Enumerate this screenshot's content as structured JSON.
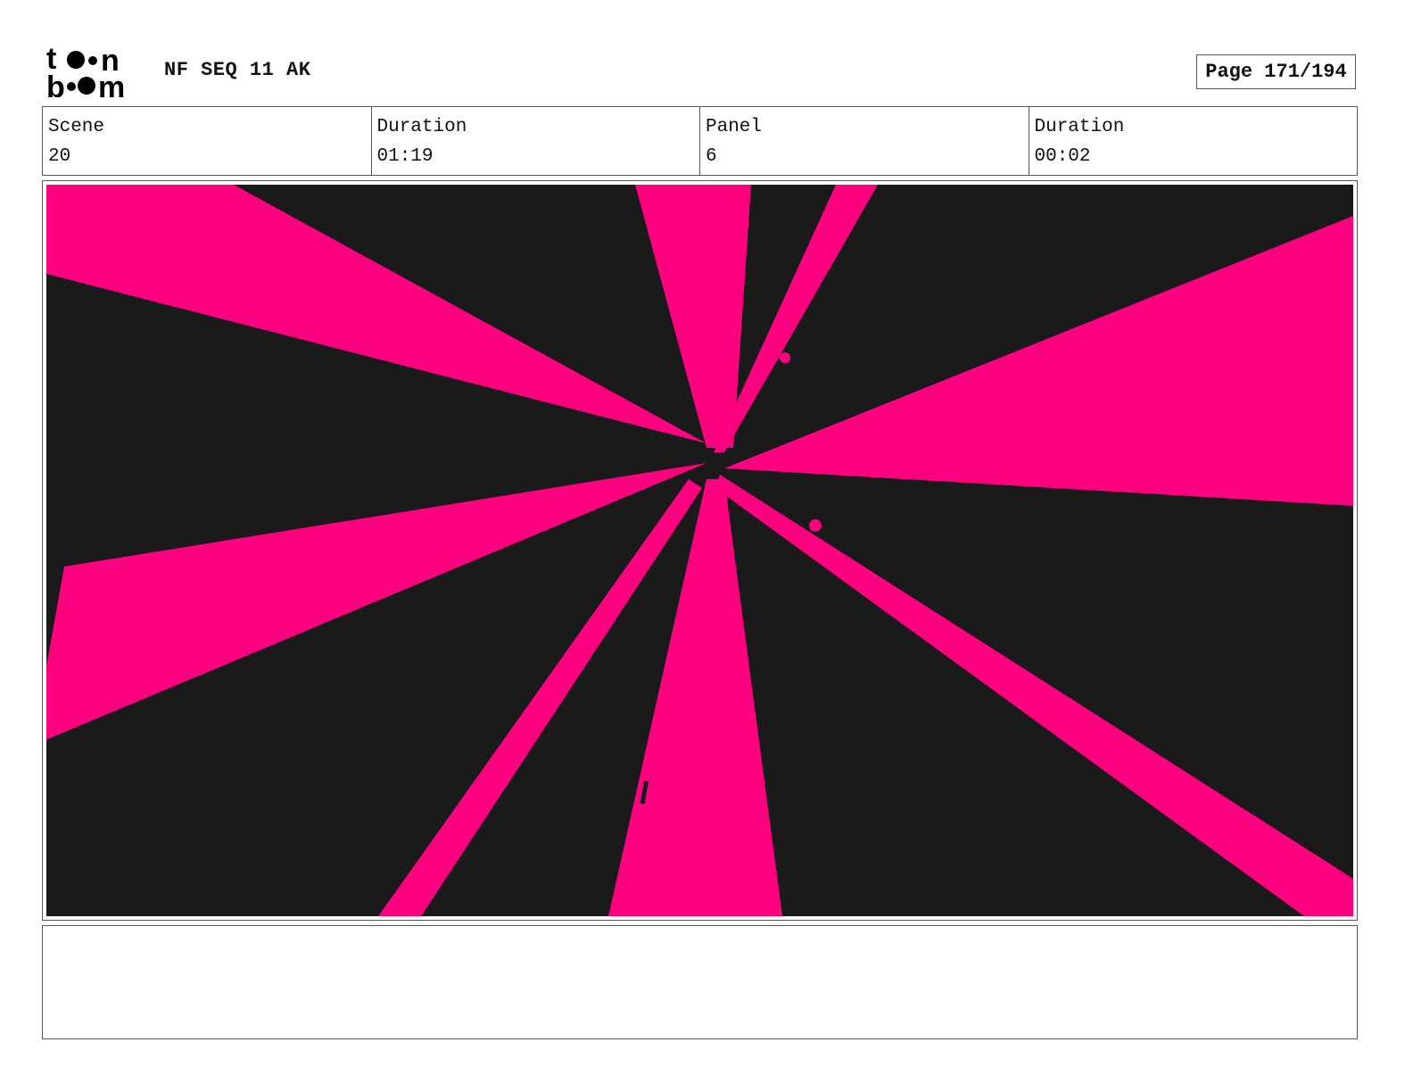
{
  "header": {
    "logo_text_top": "toon",
    "logo_text_bottom": "boom",
    "project_title": "NF SEQ 11 AK",
    "page_label": "Page 171/194"
  },
  "info": {
    "scene_label": "Scene",
    "scene_value": "20",
    "scene_duration_label": "Duration",
    "scene_duration_value": "01:19",
    "panel_label": "Panel",
    "panel_value": "6",
    "panel_duration_label": "Duration",
    "panel_duration_value": "00:02"
  },
  "panel_image": {
    "colors": {
      "background": "#1a1a1a",
      "rays": "#ff0080"
    }
  },
  "notes": {
    "text": ""
  }
}
